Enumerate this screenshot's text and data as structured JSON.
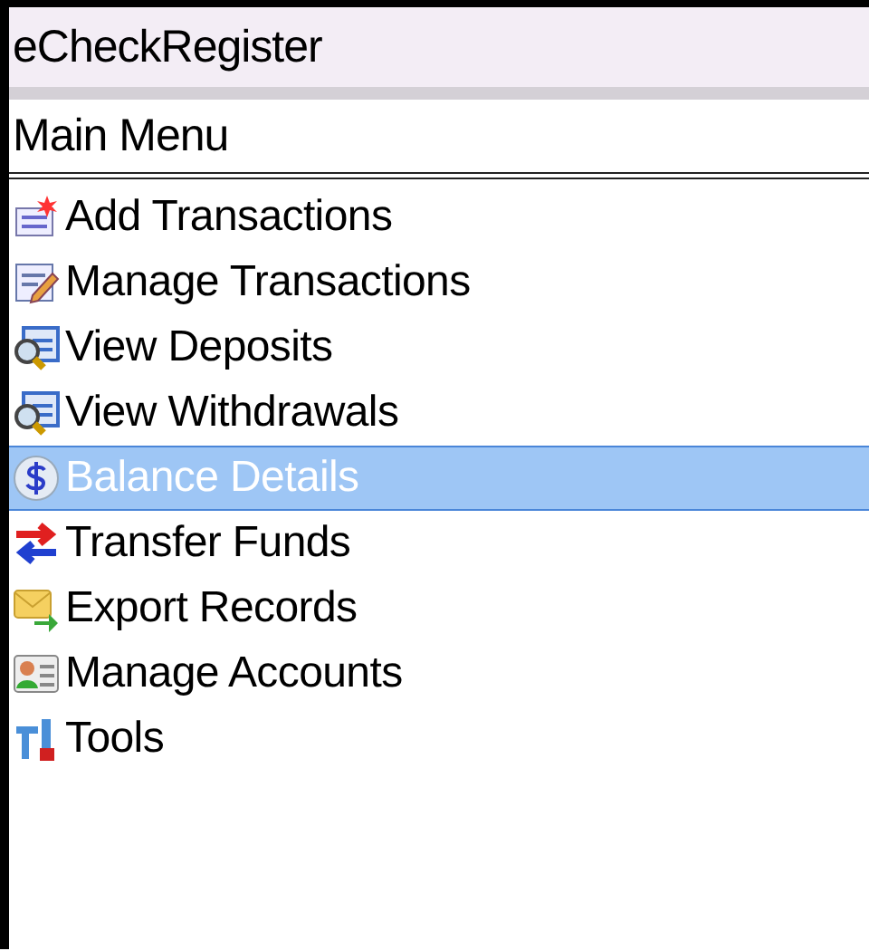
{
  "window": {
    "title": "eCheckRegister"
  },
  "screen": {
    "title": "Main Menu"
  },
  "menu": [
    {
      "label": "Add Transactions",
      "kind": "add",
      "selected": false
    },
    {
      "label": "Manage Transactions",
      "kind": "edit",
      "selected": false
    },
    {
      "label": "View Deposits",
      "kind": "view",
      "selected": false
    },
    {
      "label": "View Withdrawals",
      "kind": "view",
      "selected": false
    },
    {
      "label": "Balance Details",
      "kind": "dollar",
      "selected": true
    },
    {
      "label": "Transfer Funds",
      "kind": "transfer",
      "selected": false
    },
    {
      "label": "Export Records",
      "kind": "export",
      "selected": false
    },
    {
      "label": "Manage Accounts",
      "kind": "contact",
      "selected": false
    },
    {
      "label": "Tools",
      "kind": "tools",
      "selected": false
    }
  ]
}
